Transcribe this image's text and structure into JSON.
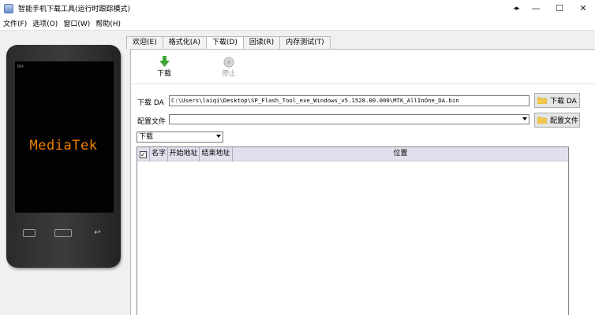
{
  "window": {
    "title": "智能手机下载工具(运行时跟踪模式)",
    "controls": {
      "extra": "◂▸",
      "minimize": "—",
      "maximize": "☐",
      "close": "✕"
    }
  },
  "menu": [
    "文件(F)",
    "选项(O)",
    "窗口(W)",
    "帮助(H)"
  ],
  "phone": {
    "brand": "BM",
    "logo_text": "MediaTek"
  },
  "tabs": [
    {
      "label": "欢迎(E)",
      "active": false
    },
    {
      "label": "格式化(A)",
      "active": false
    },
    {
      "label": "下载(D)",
      "active": true
    },
    {
      "label": "回读(R)",
      "active": false
    },
    {
      "label": "内存测试(T)",
      "active": false
    }
  ],
  "toolbar": {
    "download_label": "下载",
    "stop_label": "停止"
  },
  "download_agent": {
    "label": "下载 DA",
    "path": "C:\\Users\\laiqi\\Desktop\\SP_Flash_Tool_exe_Windows_v5.1528.00.000\\MTK_AllInOne_DA.bin",
    "button_label": "下载 DA"
  },
  "scatter_config": {
    "label": "配置文件",
    "value": "",
    "button_label": "配置文件"
  },
  "mode": {
    "selected": "下载"
  },
  "table": {
    "columns": [
      "名字",
      "开始地址",
      "结束地址",
      "位置"
    ],
    "rows": []
  },
  "colors": {
    "logo": "#f08000",
    "table_header": "#e0e0ec",
    "download_icon": "#3fa534"
  }
}
